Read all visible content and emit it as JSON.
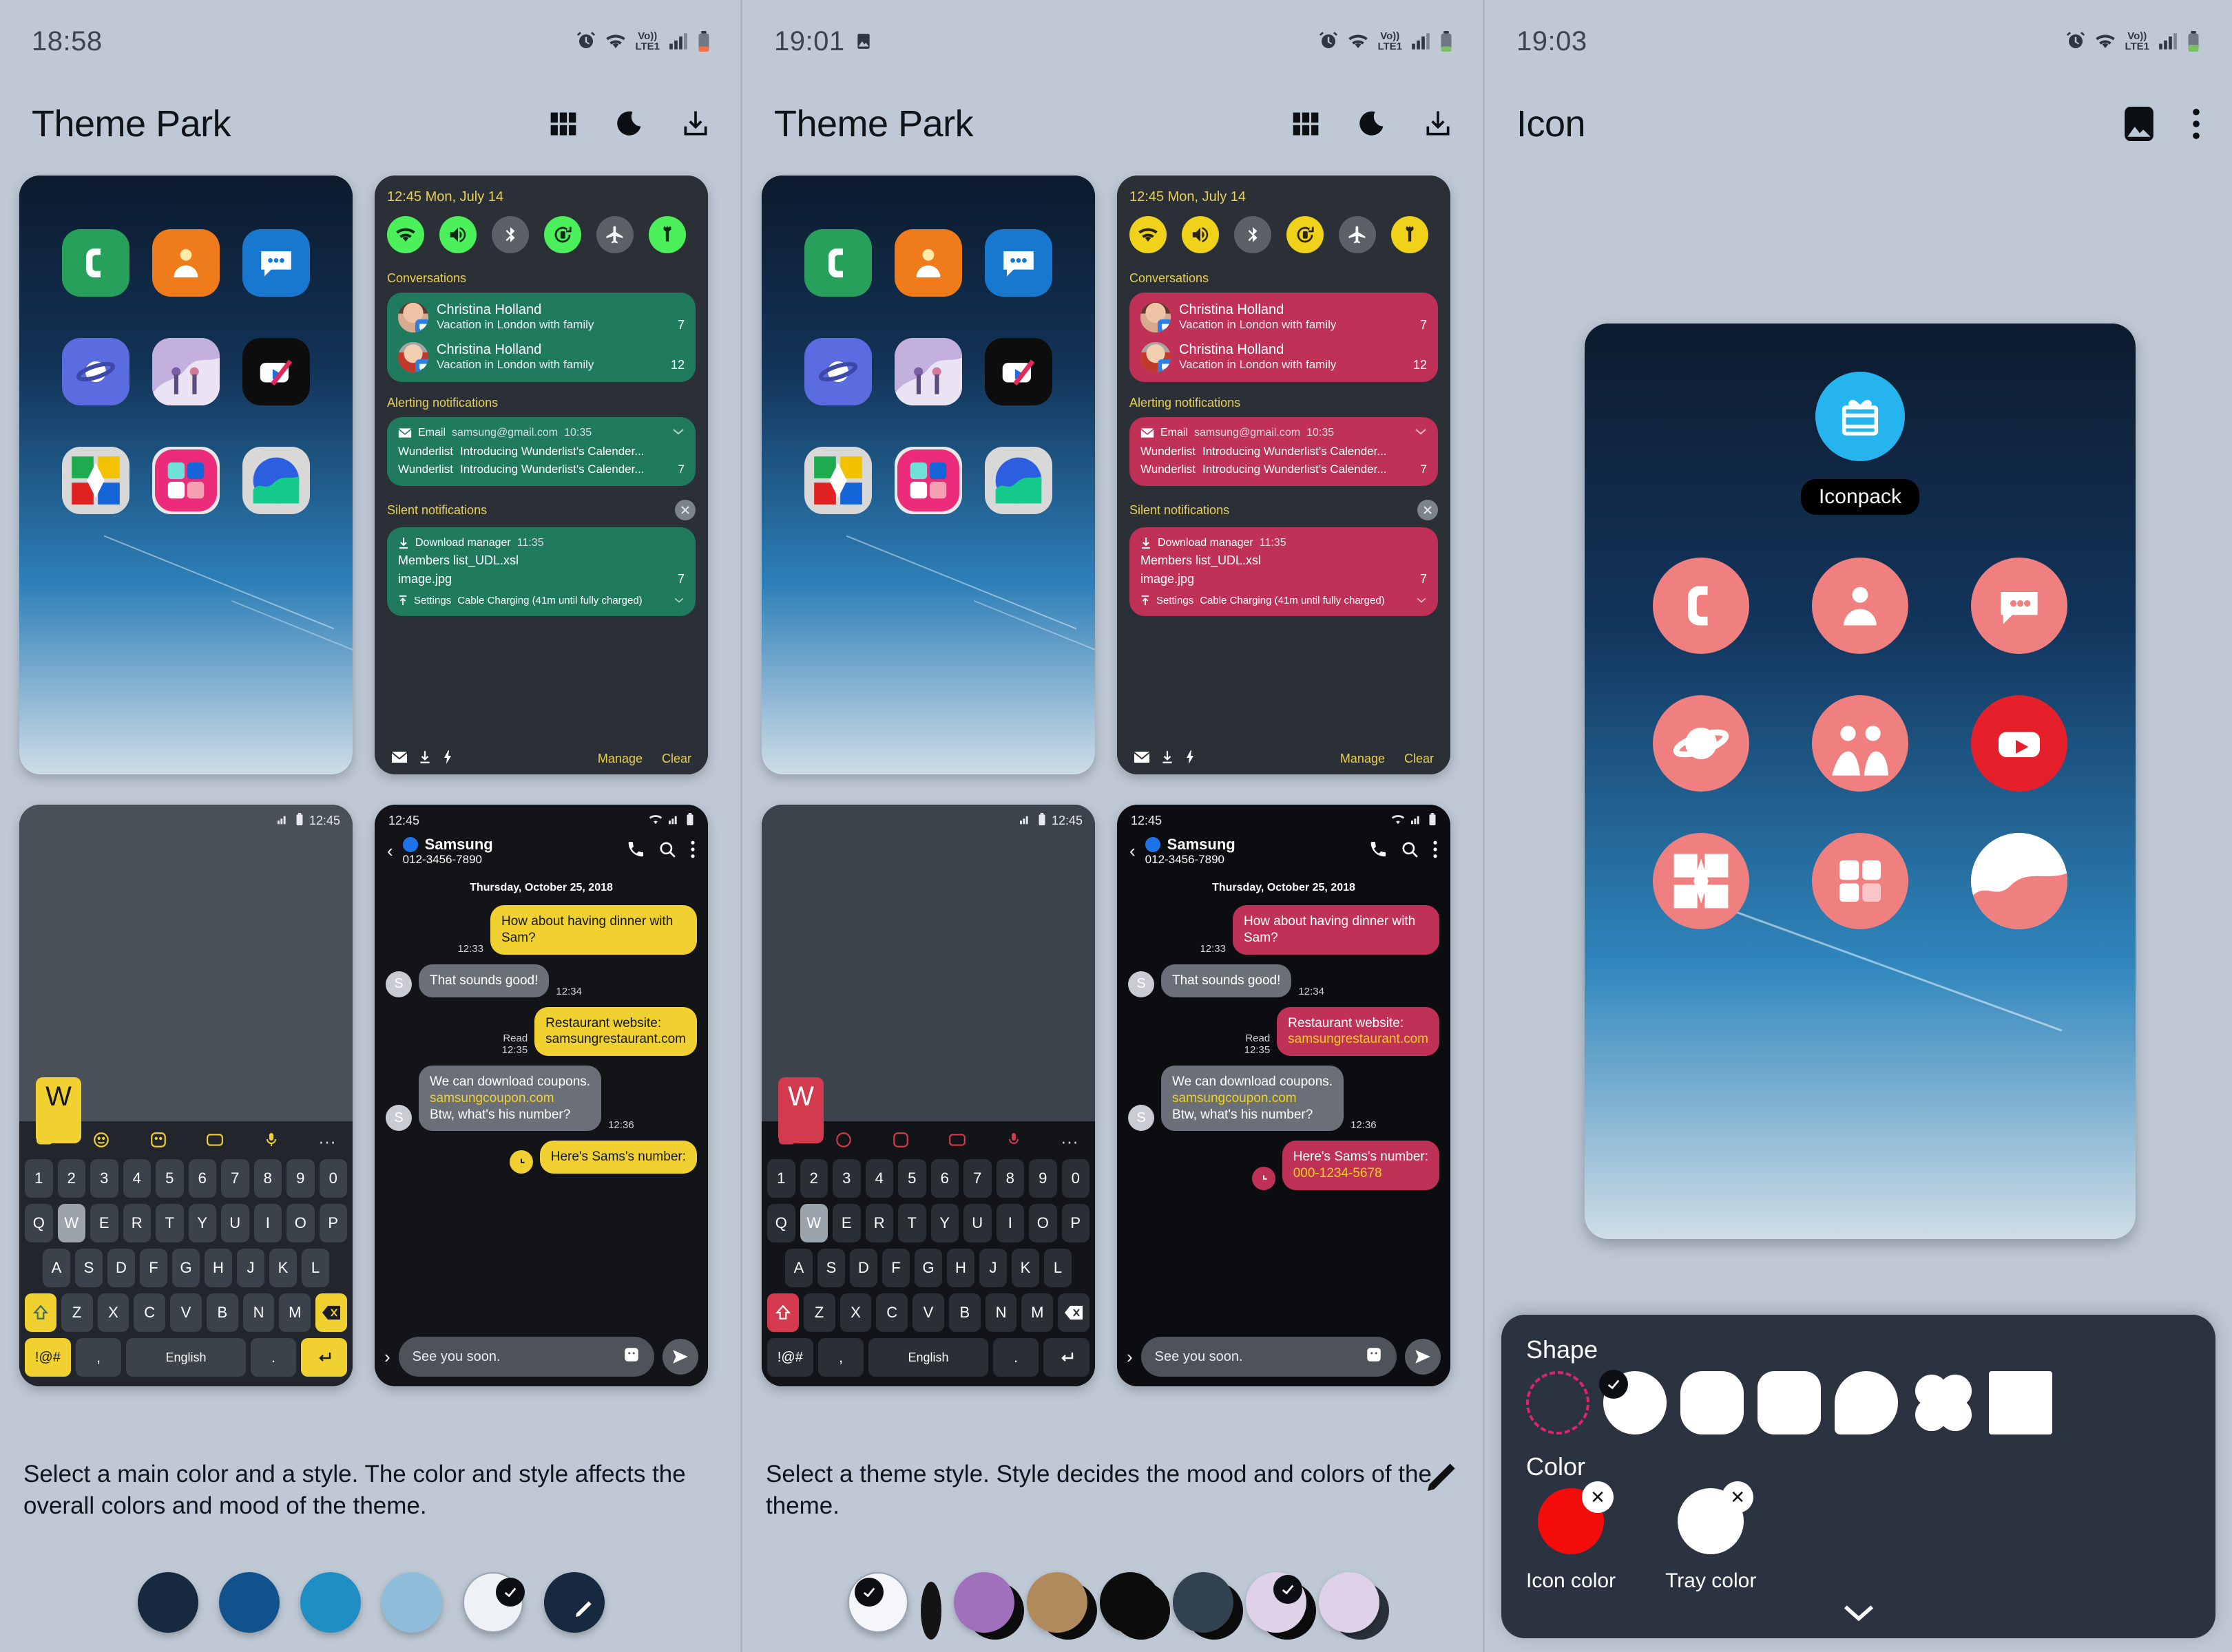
{
  "panels": [
    {
      "status": {
        "time": "18:58",
        "icons": [
          "alarm-icon",
          "wifi-icon",
          "volte-icon",
          "signal-icon",
          "battery-icon"
        ]
      },
      "appbar": {
        "title": "Theme Park",
        "actions": [
          "grid-icon",
          "moon-icon",
          "download-icon"
        ]
      },
      "description": "Select a main color and a style. The color and style affects the overall colors and mood of the theme.",
      "swatches": [
        {
          "name": "navy",
          "color": "#16293f",
          "selected": false
        },
        {
          "name": "blue",
          "color": "#11518c",
          "selected": false
        },
        {
          "name": "light-blue",
          "color": "#1e8ec4",
          "selected": false
        },
        {
          "name": "pale-blue",
          "color": "#8fbcd8",
          "selected": false
        },
        {
          "name": "white",
          "color": "#eef1f5",
          "selected": true
        },
        {
          "name": "custom",
          "color": "#16293f",
          "selected": false,
          "icon": "pencil-icon"
        }
      ]
    },
    {
      "status": {
        "time": "19:01",
        "icons": [
          "image-icon",
          "alarm-icon",
          "wifi-icon",
          "volte-icon",
          "signal-icon",
          "battery-icon"
        ]
      },
      "appbar": {
        "title": "Theme Park",
        "actions": [
          "grid-icon",
          "moon-icon",
          "download-icon"
        ]
      },
      "description": "Select a theme style. Style decides the mood and colors of the theme.",
      "edit_icon": "pencil-icon",
      "swatches": [
        {
          "name": "white-style",
          "front": "#f4f6f9",
          "back": "#f4f6f9",
          "selected": true
        },
        {
          "name": "black-style",
          "front": "#141414",
          "back": "#141414",
          "selected": false
        },
        {
          "name": "purple-style",
          "front": "#a070bd",
          "back": "#0d0d0d",
          "selected": false
        },
        {
          "name": "tan-style",
          "front": "#b08a5d",
          "back": "#0d0d0d",
          "selected": false
        },
        {
          "name": "dark-style",
          "front": "#0c0c0c",
          "back": "#0c0c0c",
          "selected": false
        },
        {
          "name": "slate-style",
          "front": "#32414f",
          "back": "#0c0c0c",
          "selected": false
        },
        {
          "name": "lilac-style",
          "front": "#ded1e8",
          "back": "#0c0c0c",
          "selected": true
        },
        {
          "name": "lavender-style",
          "front": "#ded1e8",
          "back": "#2a3038",
          "selected": false
        }
      ]
    },
    {
      "status": {
        "time": "19:03",
        "icons": [
          "alarm-icon",
          "wifi-icon",
          "volte-icon",
          "signal-icon",
          "battery-icon"
        ]
      },
      "appbar": {
        "title": "Icon",
        "actions": [
          "gallery-icon",
          "overflow-menu-icon"
        ]
      },
      "iconpack": {
        "label": "Iconpack",
        "circle_color": "#26b4ef"
      },
      "sheet": {
        "shape_label": "Shape",
        "color_label": "Color",
        "shapes": [
          {
            "name": "shape-custom-dashed",
            "type": "dashed-circle",
            "selected": false
          },
          {
            "name": "shape-circle",
            "type": "circle",
            "selected": true
          },
          {
            "name": "shape-squircle",
            "type": "squircle",
            "selected": false
          },
          {
            "name": "shape-rounded-square",
            "type": "rounded-square",
            "selected": false
          },
          {
            "name": "shape-teardrop",
            "type": "teardrop",
            "selected": false
          },
          {
            "name": "shape-clover",
            "type": "clover",
            "selected": false
          },
          {
            "name": "shape-square",
            "type": "square",
            "selected": false
          }
        ],
        "colors": [
          {
            "name": "Icon color",
            "value": "#f40c0c"
          },
          {
            "name": "Tray color",
            "value": "#ffffff"
          }
        ],
        "collapse_icon": "chevron-down-icon"
      }
    }
  ],
  "home_apps": [
    {
      "name": "phone-app",
      "bg": "#26a05a",
      "glyph": "phone"
    },
    {
      "name": "contacts-app",
      "bg": "#f07b1a",
      "glyph": "contact"
    },
    {
      "name": "messages-app",
      "bg": "#1878d0",
      "glyph": "message"
    },
    {
      "name": "internet-app",
      "bg": "#5a6ce0",
      "glyph": "planet"
    },
    {
      "name": "gallery-app",
      "bg": "#b09ad0",
      "glyph": "photo"
    },
    {
      "name": "video-app",
      "bg": "#0d0d0d",
      "glyph": "play"
    },
    {
      "name": "ludo-app",
      "bg": "#d8d8d8",
      "glyph": "ludo"
    },
    {
      "name": "puzzle-app",
      "bg": "#e8e8e8",
      "glyph": "puzzle"
    },
    {
      "name": "health-app",
      "bg": "#d8d8d8",
      "glyph": "health"
    }
  ],
  "notification_preview": {
    "time_date": "12:45 Mon, July 14",
    "quick_settings": [
      {
        "name": "wifi-toggle",
        "state": "on"
      },
      {
        "name": "sound-toggle",
        "state": "on"
      },
      {
        "name": "bluetooth-toggle",
        "state": "off"
      },
      {
        "name": "auto-rotate-toggle",
        "state": "on"
      },
      {
        "name": "airplane-toggle",
        "state": "off"
      },
      {
        "name": "flashlight-toggle",
        "state": "on"
      }
    ],
    "conversations_label": "Conversations",
    "conversations": [
      {
        "name": "Christina Holland",
        "preview": "Vacation in London with family",
        "count": "7"
      },
      {
        "name": "Christina Holland",
        "preview": "Vacation in London with family",
        "count": "12"
      }
    ],
    "alerting_label": "Alerting notifications",
    "alerting": {
      "app": "Email",
      "account": "samsung@gmail.com",
      "time": "10:35",
      "lines": [
        {
          "title": "Wunderlist",
          "body": "Introducing Wunderlist's Calender...",
          "count": ""
        },
        {
          "title": "Wunderlist",
          "body": "Introducing Wunderlist's Calender...",
          "count": "7"
        }
      ]
    },
    "silent_label": "Silent notifications",
    "silent": {
      "app": "Download manager",
      "time": "11:35",
      "files": [
        "Members list_UDL.xsl",
        "image.jpg"
      ],
      "count": "7",
      "settings_app": "Settings",
      "settings_text": "Cable Charging (41m until fully charged)"
    },
    "footer": {
      "manage": "Manage",
      "clear": "Clear"
    }
  },
  "chat_preview": {
    "status_time": "12:45",
    "contact_name": "Samsung",
    "contact_number": "012-3456-7890",
    "date": "Thursday, October 25, 2018",
    "messages": [
      {
        "side": "out",
        "text": "How about having dinner with Sam?",
        "time": "12:33"
      },
      {
        "side": "in",
        "text": "That sounds good!",
        "time": "12:34",
        "avatar": "S"
      },
      {
        "side": "out",
        "text": "Restaurant website:",
        "link": "samsungrestaurant.com",
        "time": "12:35",
        "status": "Read"
      },
      {
        "side": "in",
        "text": "We can download coupons.",
        "link": "samsungcoupon.com",
        "text2": "Btw, what's his number?",
        "time": "12:36",
        "avatar": "S"
      },
      {
        "side": "out",
        "text": "Here's Sams's number:",
        "link": "000-1234-5678",
        "time": ""
      }
    ],
    "input_value": "See you soon.",
    "send_icon": "send-icon",
    "sticker_icon": "sticker-icon"
  },
  "keyboard_preview": {
    "status_time": "12:45",
    "popup_key": "W",
    "row_numbers": [
      "1",
      "2",
      "3",
      "4",
      "5",
      "6",
      "7",
      "8",
      "9",
      "0"
    ],
    "row_top": [
      "Q",
      "W",
      "E",
      "R",
      "T",
      "Y",
      "U",
      "I",
      "O",
      "P"
    ],
    "row_top_sup": [
      "",
      "*",
      "-",
      "=",
      "/",
      "<",
      ">",
      "(",
      ")",
      ""
    ],
    "row_mid": [
      "A",
      "S",
      "D",
      "F",
      "G",
      "H",
      "J",
      "K",
      "L"
    ],
    "row_mid_sup": [
      "!",
      "@",
      "#",
      "%",
      "^",
      "&",
      "*",
      "(",
      ")"
    ],
    "row_bot": [
      "Z",
      "X",
      "C",
      "V",
      "B",
      "N",
      "M"
    ],
    "row_bot_sup": [
      "",
      "'",
      "\"",
      ":",
      ";",
      "",
      "?"
    ],
    "shift_key": "shift-icon",
    "backspace_key": "backspace-icon",
    "symbols_key": "!@#",
    "comma_key": ",",
    "space_key": "English",
    "period_key": ".",
    "enter_key": "enter-icon"
  }
}
